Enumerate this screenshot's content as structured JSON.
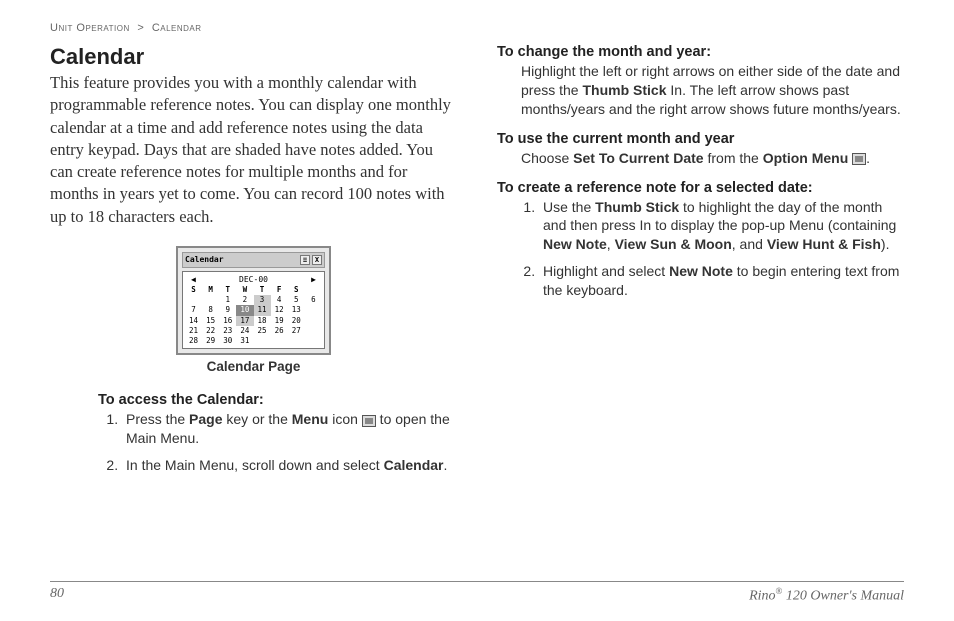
{
  "breadcrumb": {
    "section": "Unit Operation",
    "page": "Calendar"
  },
  "heading": "Calendar",
  "intro": "This feature provides you with a monthly calendar with programmable reference notes. You can display one monthly calendar at a time and add reference notes using the data entry keypad. Days that are shaded have notes added. You can create reference notes for multiple months and for months in years yet to come. You can record 100 notes with up to 18 characters each.",
  "figure_caption": "Calendar Page",
  "widget": {
    "title": "Calendar",
    "month": "DEC-00",
    "dow": [
      "S",
      "M",
      "T",
      "W",
      "T",
      "F",
      "S"
    ]
  },
  "col1": {
    "h1": "To access the Calendar:",
    "li1_a": "Press the ",
    "li1_b": "Page",
    "li1_c": " key or the ",
    "li1_d": "Menu",
    "li1_e": " icon ",
    "li1_f": " to open the Main Menu.",
    "li2_a": "In the Main Menu, scroll down and select ",
    "li2_b": "Calendar",
    "li2_c": "."
  },
  "col2": {
    "h1": "To change the month and year:",
    "p1_a": "Highlight the left or right arrows on either side of the date and press the ",
    "p1_b": "Thumb Stick",
    "p1_c": " In. The left arrow shows past months/years and the right arrow shows future months/years.",
    "h2": "To use the current month and year",
    "p2_a": "Choose ",
    "p2_b": "Set To Current Date",
    "p2_c": " from the ",
    "p2_d": "Option Menu",
    "p2_e": " ",
    "p2_f": ".",
    "h3": "To create a reference note for a selected date:",
    "li1_a": "Use the ",
    "li1_b": "Thumb Stick",
    "li1_c": " to highlight the day of the month and then press In to display the pop-up Menu (containing ",
    "li1_d": "New Note",
    "li1_e": ", ",
    "li1_f": "View Sun & Moon",
    "li1_g": ", and ",
    "li1_h": "View Hunt & Fish",
    "li1_i": ").",
    "li2_a": "Highlight and select ",
    "li2_b": "New Note",
    "li2_c": " to begin entering text from the keyboard."
  },
  "footer": {
    "page_num": "80",
    "product": "Rino",
    "doc": " 120 Owner's Manual"
  }
}
